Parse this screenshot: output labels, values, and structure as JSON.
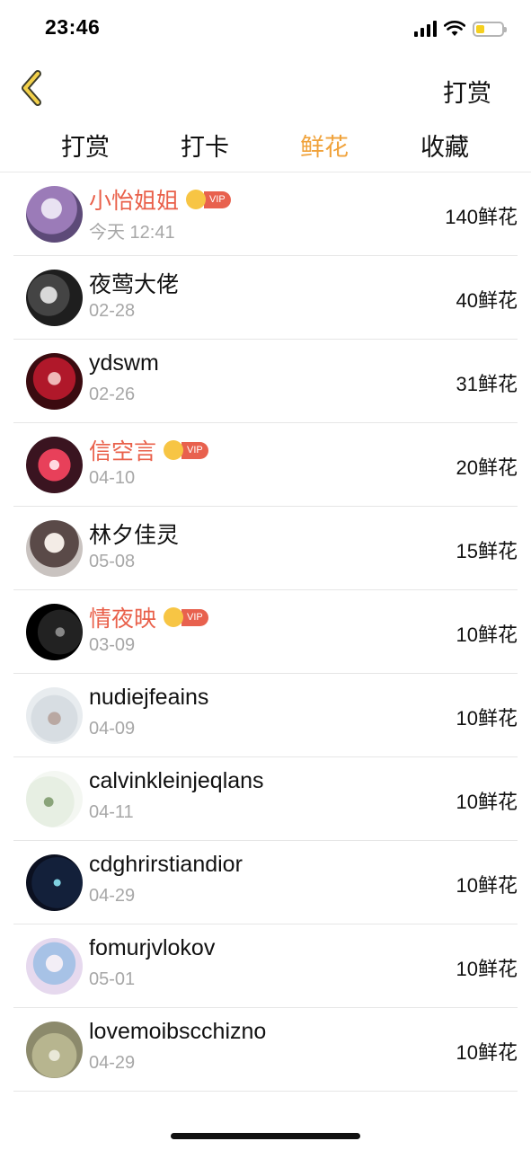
{
  "status_bar": {
    "time": "23:46"
  },
  "nav": {
    "action_label": "打赏"
  },
  "tabs": [
    {
      "label": "打赏",
      "active": false
    },
    {
      "label": "打卡",
      "active": false
    },
    {
      "label": "鲜花",
      "active": true
    },
    {
      "label": "收藏",
      "active": false
    }
  ],
  "vip_label": "VIP",
  "list": [
    {
      "name": "小怡姐姐",
      "date": "今天 12:41",
      "amount": "140鲜花",
      "vip": true
    },
    {
      "name": "夜莺大佬",
      "date": "02-28",
      "amount": "40鲜花",
      "vip": false
    },
    {
      "name": "ydswm",
      "date": "02-26",
      "amount": "31鲜花",
      "vip": false
    },
    {
      "name": "信空言",
      "date": "04-10",
      "amount": "20鲜花",
      "vip": true
    },
    {
      "name": "林夕佳灵",
      "date": "05-08",
      "amount": "15鲜花",
      "vip": false
    },
    {
      "name": "情夜映",
      "date": "03-09",
      "amount": "10鲜花",
      "vip": true
    },
    {
      "name": "nudiejfeains",
      "date": "04-09",
      "amount": "10鲜花",
      "vip": false
    },
    {
      "name": "calvinkleinjeqlans",
      "date": "04-11",
      "amount": "10鲜花",
      "vip": false
    },
    {
      "name": "cdghrirstiandior",
      "date": "04-29",
      "amount": "10鲜花",
      "vip": false
    },
    {
      "name": "fomurjvlokov",
      "date": "05-01",
      "amount": "10鲜花",
      "vip": false
    },
    {
      "name": "lovemoibscchizno",
      "date": "04-29",
      "amount": "10鲜花",
      "vip": false
    }
  ],
  "colors": {
    "accent": "#f0a23a",
    "vip_name": "#e9604a",
    "vip_badge": "#e8614e",
    "crown": "#f7c544"
  }
}
